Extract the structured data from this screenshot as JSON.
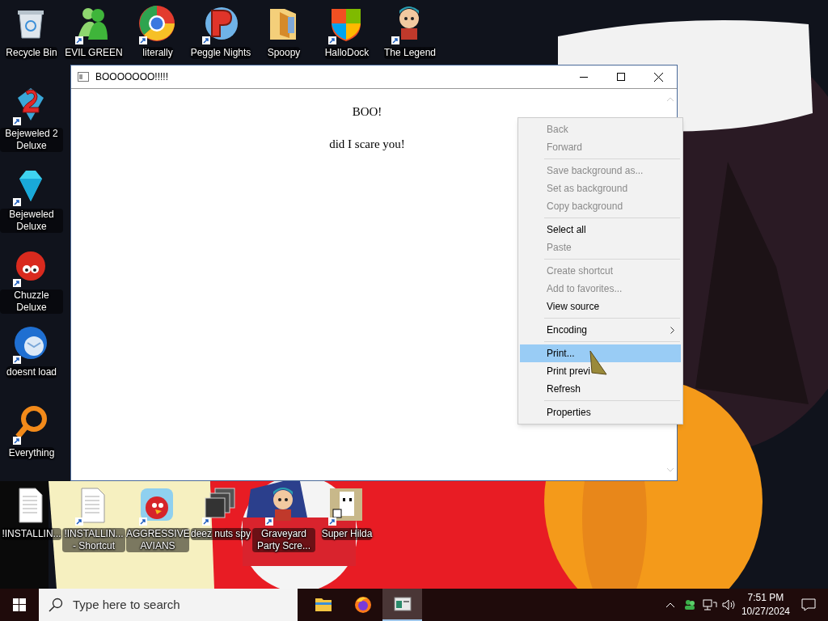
{
  "desktop_icons": [
    {
      "label": "Recycle Bin",
      "kind": "bin",
      "shortcut": false
    },
    {
      "label": "EVIL GREEN",
      "kind": "people",
      "shortcut": true
    },
    {
      "label": "literally",
      "kind": "ring",
      "shortcut": true
    },
    {
      "label": "Peggle Nights",
      "kind": "letter-badge",
      "shortcut": true
    },
    {
      "label": "Spoopy",
      "kind": "folder",
      "shortcut": false
    },
    {
      "label": "HalloDock",
      "kind": "shield",
      "shortcut": true
    },
    {
      "label": "The Legend",
      "kind": "character",
      "shortcut": true
    },
    {
      "label": "Bejeweled 2 Deluxe",
      "kind": "gem-red",
      "shortcut": true
    },
    {
      "label": "Bejeweled Deluxe",
      "kind": "gem",
      "shortcut": true
    },
    {
      "label": "Chuzzle Deluxe",
      "kind": "creature",
      "shortcut": true
    },
    {
      "label": "doesnt load",
      "kind": "bird",
      "shortcut": true
    },
    {
      "label": "Everything",
      "kind": "magnifier",
      "shortcut": true
    },
    {
      "label": "!INSTALLIN...",
      "kind": "document",
      "shortcut": false
    },
    {
      "label": "!INSTALLIN... - Shortcut",
      "kind": "document",
      "shortcut": true
    },
    {
      "label": "AGGRESSIVE AVIANS",
      "kind": "red-bird",
      "shortcut": true
    },
    {
      "label": "deez nuts spy",
      "kind": "stack",
      "shortcut": true
    },
    {
      "label": "Graveyard Party Scre...",
      "kind": "character",
      "shortcut": true
    },
    {
      "label": "Super Hilda",
      "kind": "pixel",
      "shortcut": true
    }
  ],
  "window": {
    "title": "BOOOOOOO!!!!!",
    "heading": "BOO!",
    "text": "did I scare you!"
  },
  "context_menu": {
    "groups": [
      [
        {
          "label": "Back",
          "disabled": true,
          "selected": false,
          "kind": "item"
        },
        {
          "label": "Forward",
          "disabled": true,
          "selected": false,
          "kind": "item"
        }
      ],
      [
        {
          "label": "Save background as...",
          "disabled": true,
          "selected": false,
          "kind": "item"
        },
        {
          "label": "Set as background",
          "disabled": true,
          "selected": false,
          "kind": "item"
        },
        {
          "label": "Copy background",
          "disabled": true,
          "selected": false,
          "kind": "item"
        }
      ],
      [
        {
          "label": "Select all",
          "disabled": false,
          "selected": false,
          "kind": "item"
        },
        {
          "label": "Paste",
          "disabled": true,
          "selected": false,
          "kind": "item"
        }
      ],
      [
        {
          "label": "Create shortcut",
          "disabled": true,
          "selected": false,
          "kind": "item"
        },
        {
          "label": "Add to favorites...",
          "disabled": true,
          "selected": false,
          "kind": "item"
        },
        {
          "label": "View source",
          "disabled": false,
          "selected": false,
          "kind": "item"
        }
      ],
      [
        {
          "label": "Encoding",
          "disabled": false,
          "selected": false,
          "kind": "submenu"
        }
      ],
      [
        {
          "label": "Print...",
          "disabled": false,
          "selected": true,
          "kind": "item"
        },
        {
          "label": "Print previ",
          "disabled": false,
          "selected": false,
          "kind": "item"
        },
        {
          "label": "Refresh",
          "disabled": false,
          "selected": false,
          "kind": "item"
        }
      ],
      [
        {
          "label": "Properties",
          "disabled": false,
          "selected": false,
          "kind": "item"
        }
      ]
    ]
  },
  "taskbar": {
    "search": {
      "placeholder": "Type here to search"
    },
    "apps": [
      {
        "kind": "folder",
        "selected": false
      },
      {
        "kind": "browser",
        "selected": false
      },
      {
        "kind": "window",
        "selected": true
      }
    ],
    "time": "7:51 PM",
    "date": "10/27/2024"
  }
}
